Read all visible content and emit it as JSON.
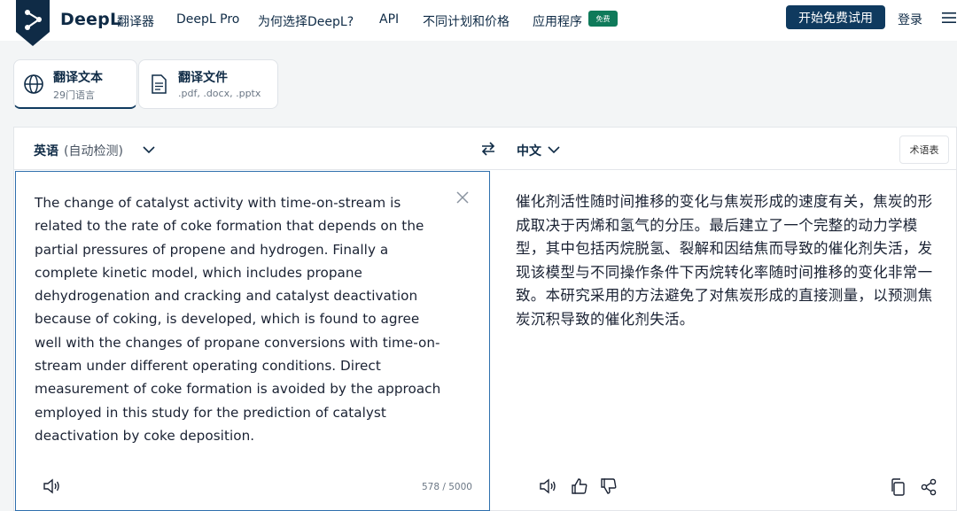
{
  "header": {
    "brand": "DeepL",
    "brand_sub": "翻译器",
    "nav": [
      "DeepL Pro",
      "为何选择DeepL?",
      "API",
      "不同计划和价格",
      "应用程序"
    ],
    "badge": "免费",
    "cta_label": "开始免费试用",
    "login_label": "登录"
  },
  "mode_tabs": [
    {
      "title": "翻译文本",
      "subtitle": "29门语言"
    },
    {
      "title": "翻译文件",
      "subtitle": ".pdf, .docx, .pptx"
    }
  ],
  "translator": {
    "source_lang": "英语",
    "source_detect": "(自动检测)",
    "target_lang": "中文",
    "glossary_label": "术语表",
    "source_text": "The change of catalyst activity with time-on-stream is related to the rate of coke formation that depends on the partial pressures of propene and hydrogen. Finally a complete kinetic model, which includes propane dehydrogenation and cracking and catalyst deactivation because of coking, is developed, which is found to agree well with the changes of propane conversions with time-on-stream under different operating conditions. Direct measurement of coke formation is avoided by the approach employed in this study for the prediction of catalyst deactivation by coke deposition.",
    "char_count": "578 / 5000",
    "target_text": "催化剂活性随时间推移的变化与焦炭形成的速度有关，焦炭的形成取决于丙烯和氢气的分压。最后建立了一个完整的动力学模型，其中包括丙烷脱氢、裂解和因结焦而导致的催化剂失活，发现该模型与不同操作条件下丙烷转化率随时间推移的变化非常一致。本研究采用的方法避免了对焦炭形成的直接测量，以预测焦炭沉积导致的催化剂失活。"
  },
  "colors": {
    "brand": "#0f2b46",
    "cta_bg": "#0f3a5f",
    "badge_bg": "#0f7a5a",
    "focus_border": "#2f6fad"
  }
}
